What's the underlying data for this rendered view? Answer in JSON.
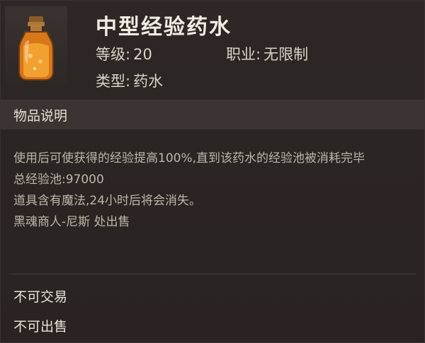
{
  "item": {
    "name": "中型经验药水",
    "icon": "orange-potion-bottle-icon",
    "level_label": "等级:",
    "level_value": "20",
    "class_label": "职业:",
    "class_value": "无限制",
    "type_label": "类型:",
    "type_value": "药水"
  },
  "section": {
    "title": "物品说明"
  },
  "description": {
    "line1": "使用后可使获得的经验提高100%,直到该药水的经验池被消耗完毕",
    "line2": "总经验池:97000",
    "line3": "道具含有魔法,24小时后将会消失。",
    "line4": "黑魂商人-尼斯 处出售"
  },
  "flags": {
    "no_trade": "不可交易",
    "no_sell": "不可出售"
  },
  "colors": {
    "background": "#2a2422",
    "section_bar": "#3b3432",
    "potion_orange": "#e88a1a",
    "cork": "#9a6a2e"
  }
}
